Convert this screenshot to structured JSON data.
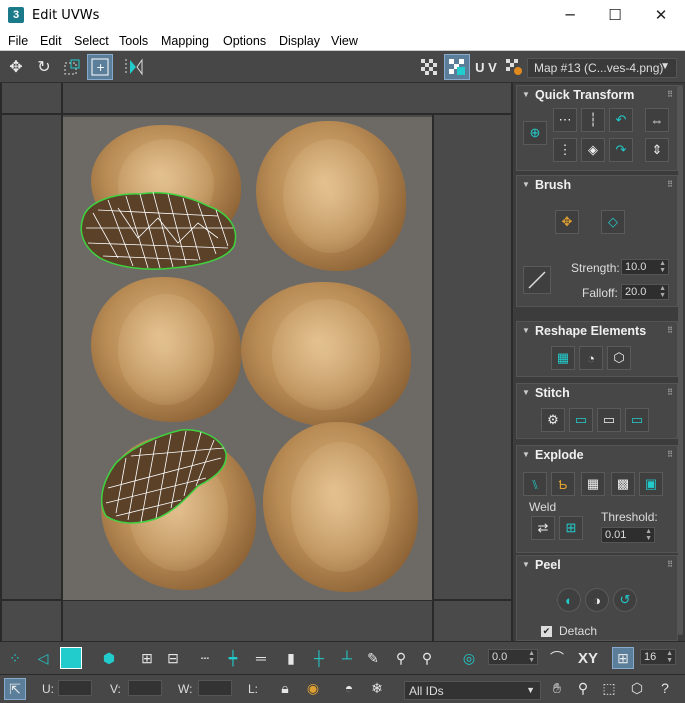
{
  "window": {
    "title": "Edit UVWs",
    "app_icon": "3",
    "minimize": "─",
    "maximize": "☐",
    "close": "✕"
  },
  "menu": [
    "File",
    "Edit",
    "Select",
    "Tools",
    "Mapping",
    "Options",
    "Display",
    "View"
  ],
  "toolbar": {
    "uv_label": "U V",
    "map_dropdown": "Map #13 (C...ves-4.png)"
  },
  "quick_transform": {
    "title": "Quick Transform"
  },
  "brush": {
    "title": "Brush",
    "strength_label": "Strength:",
    "strength_value": "10.0",
    "falloff_label": "Falloff:",
    "falloff_value": "20.0"
  },
  "reshape": {
    "title": "Reshape Elements"
  },
  "stitch": {
    "title": "Stitch"
  },
  "explode": {
    "title": "Explode",
    "weld_label": "Weld",
    "threshold_label": "Threshold:",
    "threshold_value": "0.01"
  },
  "peel": {
    "title": "Peel",
    "detach_label": "Detach"
  },
  "bottom": {
    "angle_value": "0.0",
    "xy_label": "XY",
    "grid_value": "16",
    "u_label": "U:",
    "v_label": "V:",
    "w_label": "W:",
    "l_label": "L:",
    "ids_dropdown": "All IDs"
  },
  "colors": {
    "panel_bg": "#3c3c3c",
    "accent_teal": "#22cccc",
    "uv_edge_green": "#3fd23f"
  }
}
